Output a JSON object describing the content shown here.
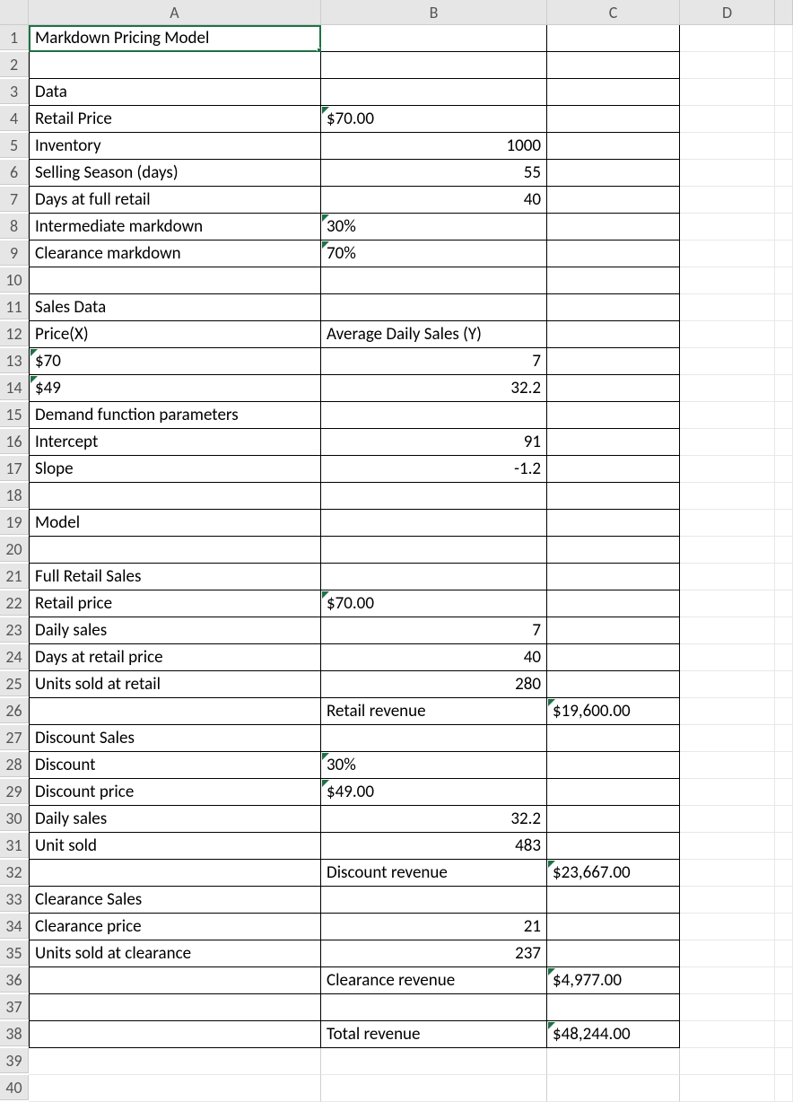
{
  "colHeaders": [
    "A",
    "B",
    "C",
    "D",
    ""
  ],
  "rowCount": 40,
  "selectedCell": "A1",
  "rows": {
    "1": {
      "A": {
        "v": "Markdown Pricing Model",
        "a": "txt"
      }
    },
    "2": {},
    "3": {
      "A": {
        "v": "Data",
        "a": "txt"
      }
    },
    "4": {
      "A": {
        "v": "Retail Price",
        "a": "txt"
      },
      "B": {
        "v": "$70.00",
        "a": "txt",
        "tri": true
      }
    },
    "5": {
      "A": {
        "v": "Inventory",
        "a": "txt"
      },
      "B": {
        "v": "1000",
        "a": "num"
      }
    },
    "6": {
      "A": {
        "v": "Selling Season (days)",
        "a": "txt"
      },
      "B": {
        "v": "55",
        "a": "num"
      }
    },
    "7": {
      "A": {
        "v": "Days at full retail",
        "a": "txt"
      },
      "B": {
        "v": "40",
        "a": "num"
      }
    },
    "8": {
      "A": {
        "v": "Intermediate markdown",
        "a": "txt"
      },
      "B": {
        "v": "30%",
        "a": "txt",
        "tri": true
      }
    },
    "9": {
      "A": {
        "v": "Clearance markdown",
        "a": "txt"
      },
      "B": {
        "v": "70%",
        "a": "txt",
        "tri": true
      }
    },
    "10": {},
    "11": {
      "A": {
        "v": "Sales Data",
        "a": "txt"
      }
    },
    "12": {
      "A": {
        "v": "Price(X)",
        "a": "txt"
      },
      "B": {
        "v": "Average Daily Sales (Y)",
        "a": "txt"
      }
    },
    "13": {
      "A": {
        "v": "$70",
        "a": "txt",
        "tri": true
      },
      "B": {
        "v": "7",
        "a": "num"
      }
    },
    "14": {
      "A": {
        "v": "$49",
        "a": "txt",
        "tri": true
      },
      "B": {
        "v": "32.2",
        "a": "num"
      }
    },
    "15": {
      "A": {
        "v": "Demand function parameters",
        "a": "txt"
      }
    },
    "16": {
      "A": {
        "v": "Intercept",
        "a": "txt"
      },
      "B": {
        "v": "91",
        "a": "num"
      }
    },
    "17": {
      "A": {
        "v": "Slope",
        "a": "txt"
      },
      "B": {
        "v": "-1.2",
        "a": "num"
      }
    },
    "18": {},
    "19": {
      "A": {
        "v": "Model",
        "a": "txt"
      }
    },
    "20": {},
    "21": {
      "A": {
        "v": "Full Retail Sales",
        "a": "txt"
      }
    },
    "22": {
      "A": {
        "v": "Retail price",
        "a": "txt"
      },
      "B": {
        "v": "$70.00",
        "a": "txt",
        "tri": true
      }
    },
    "23": {
      "A": {
        "v": "Daily sales",
        "a": "txt"
      },
      "B": {
        "v": "7",
        "a": "num"
      }
    },
    "24": {
      "A": {
        "v": "Days at retail price",
        "a": "txt"
      },
      "B": {
        "v": "40",
        "a": "num"
      }
    },
    "25": {
      "A": {
        "v": "Units sold at retail",
        "a": "txt"
      },
      "B": {
        "v": "280",
        "a": "num"
      }
    },
    "26": {
      "B": {
        "v": "Retail revenue",
        "a": "txt"
      },
      "C": {
        "v": "$19,600.00",
        "a": "txt",
        "tri": true
      }
    },
    "27": {
      "A": {
        "v": "Discount Sales",
        "a": "txt"
      }
    },
    "28": {
      "A": {
        "v": "Discount",
        "a": "txt"
      },
      "B": {
        "v": "30%",
        "a": "txt",
        "tri": true
      }
    },
    "29": {
      "A": {
        "v": "Discount price",
        "a": "txt"
      },
      "B": {
        "v": "$49.00",
        "a": "txt",
        "tri": true
      }
    },
    "30": {
      "A": {
        "v": "Daily sales",
        "a": "txt"
      },
      "B": {
        "v": "32.2",
        "a": "num"
      }
    },
    "31": {
      "A": {
        "v": "Unit sold",
        "a": "txt"
      },
      "B": {
        "v": "483",
        "a": "num"
      }
    },
    "32": {
      "B": {
        "v": "Discount revenue",
        "a": "txt"
      },
      "C": {
        "v": "$23,667.00",
        "a": "txt",
        "tri": true
      }
    },
    "33": {
      "A": {
        "v": "Clearance Sales",
        "a": "txt"
      }
    },
    "34": {
      "A": {
        "v": "Clearance price",
        "a": "txt"
      },
      "B": {
        "v": "21",
        "a": "num"
      }
    },
    "35": {
      "A": {
        "v": "Units sold at clearance",
        "a": "txt"
      },
      "B": {
        "v": "237",
        "a": "num"
      }
    },
    "36": {
      "B": {
        "v": "Clearance revenue",
        "a": "txt"
      },
      "C": {
        "v": "$4,977.00",
        "a": "txt",
        "tri": true
      }
    },
    "37": {},
    "38": {
      "B": {
        "v": "Total revenue",
        "a": "txt"
      },
      "C": {
        "v": "$48,244.00",
        "a": "txt",
        "tri": true
      }
    },
    "39": {},
    "40": {}
  },
  "borderedRows": {
    "from": 1,
    "to": 38,
    "cols": [
      "A",
      "B",
      "C"
    ]
  }
}
